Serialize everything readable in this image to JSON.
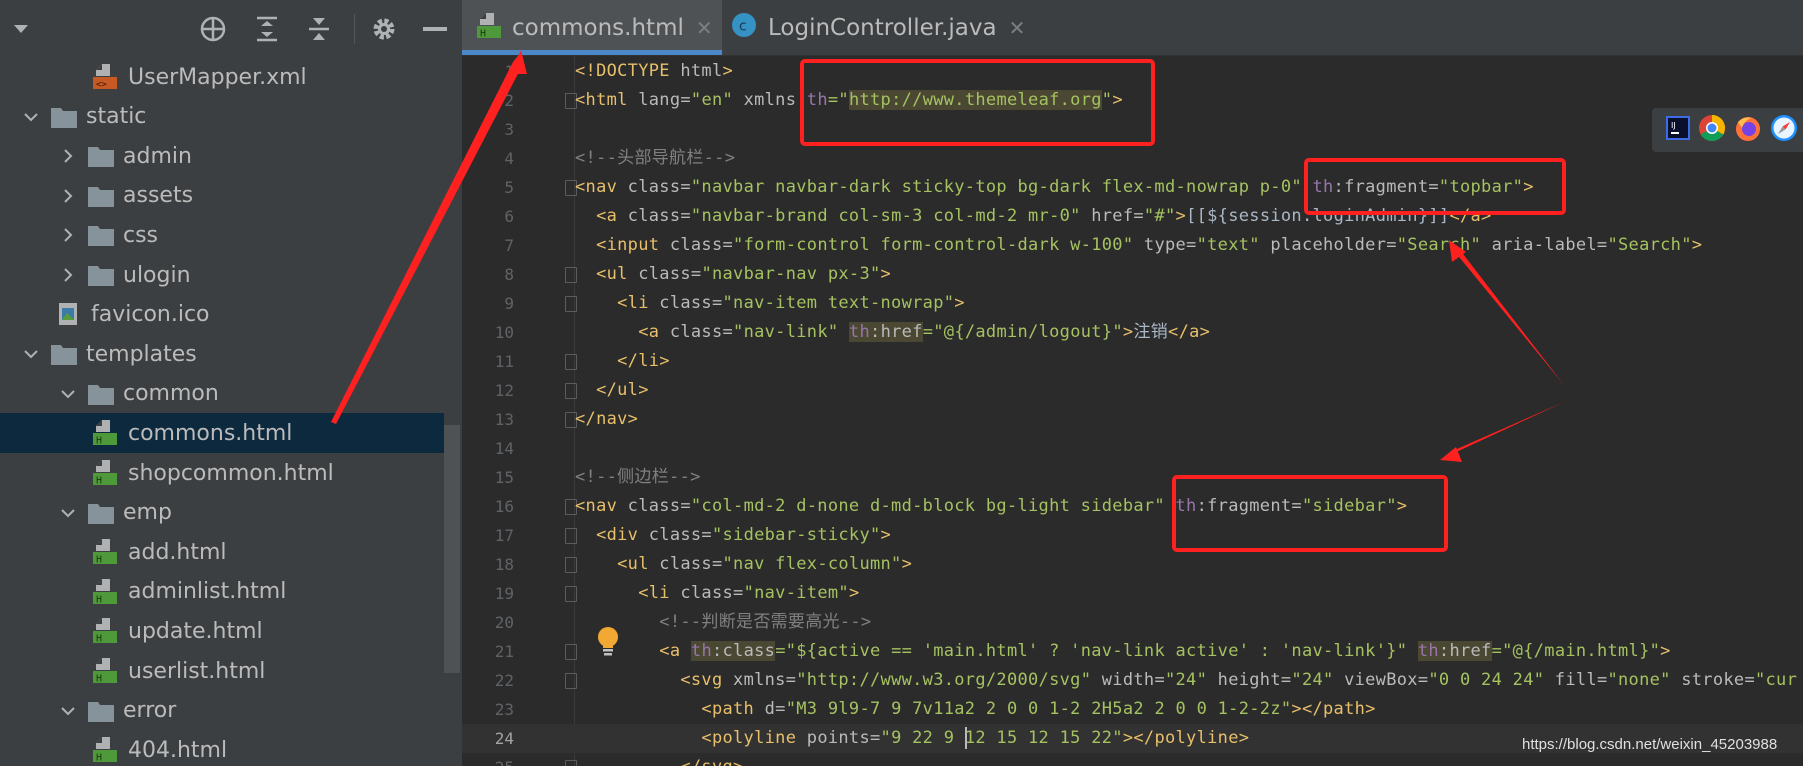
{
  "sidebar": {
    "toolbar": [
      "locate-icon",
      "expand-all-icon",
      "collapse-all-icon",
      "gear-icon",
      "minimize-icon"
    ],
    "items": [
      {
        "label": "UserMapper.xml",
        "level": 3,
        "type": "xml"
      },
      {
        "label": "static",
        "level": 1,
        "type": "folder",
        "expanded": true
      },
      {
        "label": "admin",
        "level": 2,
        "type": "folder",
        "expanded": false
      },
      {
        "label": "assets",
        "level": 2,
        "type": "folder",
        "expanded": false
      },
      {
        "label": "css",
        "level": 2,
        "type": "folder",
        "expanded": false
      },
      {
        "label": "ulogin",
        "level": 2,
        "type": "folder",
        "expanded": false
      },
      {
        "label": "favicon.ico",
        "level": 2,
        "type": "image"
      },
      {
        "label": "templates",
        "level": 1,
        "type": "folder",
        "expanded": true
      },
      {
        "label": "common",
        "level": 2,
        "type": "folder",
        "expanded": true
      },
      {
        "label": "commons.html",
        "level": 3,
        "type": "html",
        "selected": true
      },
      {
        "label": "shopcommon.html",
        "level": 3,
        "type": "html"
      },
      {
        "label": "emp",
        "level": 2,
        "type": "folder",
        "expanded": true
      },
      {
        "label": "add.html",
        "level": 3,
        "type": "html"
      },
      {
        "label": "adminlist.html",
        "level": 3,
        "type": "html"
      },
      {
        "label": "update.html",
        "level": 3,
        "type": "html"
      },
      {
        "label": "userlist.html",
        "level": 3,
        "type": "html"
      },
      {
        "label": "error",
        "level": 2,
        "type": "folder",
        "expanded": true
      },
      {
        "label": "404.html",
        "level": 3,
        "type": "html"
      }
    ]
  },
  "tabs": [
    {
      "label": "commons.html",
      "icon": "html-file-icon",
      "active": true
    },
    {
      "label": "LoginController.java",
      "icon": "java-class-icon",
      "active": false
    }
  ],
  "editor": {
    "current_line": 24,
    "lines": [
      [
        [
          "t",
          "<!DOCTYPE"
        ],
        [
          "a",
          " html"
        ],
        [
          "t",
          ">"
        ]
      ],
      [
        [
          "t",
          "<html"
        ],
        [
          "a",
          " lang="
        ],
        [
          "v",
          "\"en\""
        ],
        [
          "a",
          " xmlns "
        ],
        [
          "p",
          "th"
        ],
        [
          "v",
          "=\""
        ],
        [
          "v hl",
          "http://www.themeleaf.org"
        ],
        [
          "v",
          "\""
        ],
        [
          "t",
          ">"
        ]
      ],
      [],
      [
        [
          "c",
          "<!--头部导航栏-->"
        ]
      ],
      [
        [
          "t",
          "<nav"
        ],
        [
          "a",
          " class="
        ],
        [
          "v",
          "\"navbar navbar-dark sticky-top bg-dark flex-md-nowrap p-0\""
        ],
        [
          "a",
          " "
        ],
        [
          "p",
          "th"
        ],
        [
          "a",
          ":fragment="
        ],
        [
          "v",
          "\"topbar\""
        ],
        [
          "t",
          ">"
        ]
      ],
      [
        [
          "x",
          "  "
        ],
        [
          "t",
          "<a"
        ],
        [
          "a",
          " class="
        ],
        [
          "v",
          "\"navbar-brand col-sm-3 col-md-2 mr-0\""
        ],
        [
          "a",
          " href="
        ],
        [
          "v",
          "\"#\""
        ],
        [
          "t",
          ">"
        ],
        [
          "x",
          "[[${session.loginAdmin}]]"
        ],
        [
          "t",
          "</a>"
        ]
      ],
      [
        [
          "x",
          "  "
        ],
        [
          "t",
          "<input"
        ],
        [
          "a",
          " class="
        ],
        [
          "v",
          "\"form-control form-control-dark w-100\""
        ],
        [
          "a",
          " type="
        ],
        [
          "v",
          "\"text\""
        ],
        [
          "a",
          " placeholder="
        ],
        [
          "v",
          "\"Search\""
        ],
        [
          "a",
          " aria-label="
        ],
        [
          "v",
          "\"Search\""
        ],
        [
          "t",
          ">"
        ]
      ],
      [
        [
          "x",
          "  "
        ],
        [
          "t",
          "<ul"
        ],
        [
          "a",
          " class="
        ],
        [
          "v",
          "\"navbar-nav px-3\""
        ],
        [
          "t",
          ">"
        ]
      ],
      [
        [
          "x",
          "    "
        ],
        [
          "t",
          "<li"
        ],
        [
          "a",
          " class="
        ],
        [
          "v",
          "\"nav-item text-nowrap\""
        ],
        [
          "t",
          ">"
        ]
      ],
      [
        [
          "x",
          "      "
        ],
        [
          "t",
          "<a"
        ],
        [
          "a",
          " class="
        ],
        [
          "v",
          "\"nav-link\""
        ],
        [
          "a",
          " "
        ],
        [
          "p hl",
          "th"
        ],
        [
          "a hl",
          ":href"
        ],
        [
          "v",
          "=\"@{/admin/logout}\""
        ],
        [
          "t",
          ">"
        ],
        [
          "x",
          "注销"
        ],
        [
          "t",
          "</a>"
        ]
      ],
      [
        [
          "x",
          "    "
        ],
        [
          "t",
          "</li>"
        ]
      ],
      [
        [
          "x",
          "  "
        ],
        [
          "t",
          "</ul>"
        ]
      ],
      [
        [
          "t",
          "</nav>"
        ]
      ],
      [],
      [
        [
          "c",
          "<!--侧边栏-->"
        ]
      ],
      [
        [
          "t",
          "<nav"
        ],
        [
          "a",
          " class="
        ],
        [
          "v",
          "\"col-md-2 d-none d-md-block bg-light sidebar\""
        ],
        [
          "a",
          " "
        ],
        [
          "p",
          "th"
        ],
        [
          "a",
          ":fragment="
        ],
        [
          "v",
          "\"sidebar\""
        ],
        [
          "t",
          ">"
        ]
      ],
      [
        [
          "x",
          "  "
        ],
        [
          "t",
          "<div"
        ],
        [
          "a",
          " class="
        ],
        [
          "v",
          "\"sidebar-sticky\""
        ],
        [
          "t",
          ">"
        ]
      ],
      [
        [
          "x",
          "    "
        ],
        [
          "t",
          "<ul"
        ],
        [
          "a",
          " class="
        ],
        [
          "v",
          "\"nav flex-column\""
        ],
        [
          "t",
          ">"
        ]
      ],
      [
        [
          "x",
          "      "
        ],
        [
          "t",
          "<li"
        ],
        [
          "a",
          " class="
        ],
        [
          "v",
          "\"nav-item\""
        ],
        [
          "t",
          ">"
        ]
      ],
      [
        [
          "x",
          "        "
        ],
        [
          "c",
          "<!--判断是否需要高光-->"
        ]
      ],
      [
        [
          "x",
          "        "
        ],
        [
          "t",
          "<a"
        ],
        [
          "a",
          " "
        ],
        [
          "p hl",
          "th"
        ],
        [
          "a hl",
          ":class"
        ],
        [
          "v",
          "=\"${active == 'main.html' ? 'nav-link active' : 'nav-link'}\""
        ],
        [
          "a",
          " "
        ],
        [
          "p hl",
          "th"
        ],
        [
          "a hl",
          ":href"
        ],
        [
          "v",
          "=\"@{/main.html}\""
        ],
        [
          "t",
          ">"
        ]
      ],
      [
        [
          "x",
          "          "
        ],
        [
          "t",
          "<svg"
        ],
        [
          "a",
          " xmlns="
        ],
        [
          "v",
          "\"http://www.w3.org/2000/svg\""
        ],
        [
          "a",
          " width="
        ],
        [
          "v",
          "\"24\""
        ],
        [
          "a",
          " height="
        ],
        [
          "v",
          "\"24\""
        ],
        [
          "a",
          " viewBox="
        ],
        [
          "v",
          "\"0 0 24 24\""
        ],
        [
          "a",
          " fill="
        ],
        [
          "v",
          "\"none\""
        ],
        [
          "a",
          " stroke="
        ],
        [
          "v",
          "\"cur"
        ]
      ],
      [
        [
          "x",
          "            "
        ],
        [
          "t",
          "<path"
        ],
        [
          "a",
          " d="
        ],
        [
          "v",
          "\"M3 9l9-7 9 7v11a2 2 0 0 1-2 2H5a2 2 0 0 1-2-2z\""
        ],
        [
          "t",
          "></path>"
        ]
      ],
      [
        [
          "x",
          "            "
        ],
        [
          "t",
          "<polyline"
        ],
        [
          "a",
          " points="
        ],
        [
          "v",
          "\"9 22 9 "
        ],
        [
          "caret",
          ""
        ],
        [
          "v",
          "12 15 12 15 22\""
        ],
        [
          "t",
          "></polyline>"
        ]
      ],
      [
        [
          "x",
          "          "
        ],
        [
          "t",
          "</svg>"
        ]
      ]
    ],
    "fold_lines": [
      2,
      5,
      8,
      9,
      11,
      12,
      13,
      16,
      17,
      18,
      19,
      21,
      22,
      25
    ]
  },
  "browsers": [
    "intellij-icon",
    "chrome-icon",
    "firefox-icon",
    "safari-icon"
  ],
  "watermark": "https://blog.csdn.net/weixin_45203988",
  "colors": {
    "annotation": "#ff2020",
    "accent": "#4a88c7",
    "selection": "#0d293e",
    "html_icon": "#4e9a3a"
  }
}
